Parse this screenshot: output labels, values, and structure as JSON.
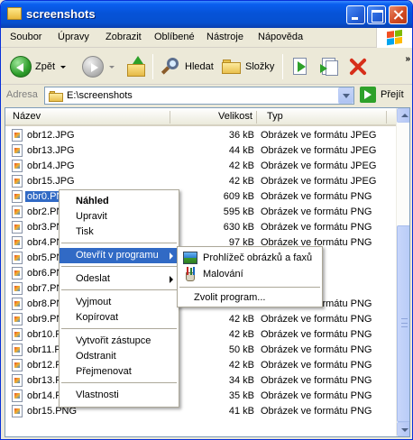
{
  "window": {
    "title": "screenshots"
  },
  "menubar": [
    {
      "label": "Soubor"
    },
    {
      "label": "Úpravy"
    },
    {
      "label": "Zobrazit"
    },
    {
      "label": "Oblíbené"
    },
    {
      "label": "Nástroje"
    },
    {
      "label": "Nápověda"
    }
  ],
  "toolbar": {
    "back_label": "Zpět",
    "search_label": "Hledat",
    "folders_label": "Složky",
    "chevron": "»"
  },
  "address": {
    "label": "Adresa",
    "value": "E:\\screenshots",
    "go_label": "Přejít"
  },
  "columns": {
    "name": "Název",
    "size": "Velikost",
    "type": "Typ"
  },
  "files": [
    {
      "name": "obr12.JPG",
      "size": "36 kB",
      "type": "Obrázek ve formátu JPEG"
    },
    {
      "name": "obr13.JPG",
      "size": "44 kB",
      "type": "Obrázek ve formátu JPEG"
    },
    {
      "name": "obr14.JPG",
      "size": "42 kB",
      "type": "Obrázek ve formátu JPEG"
    },
    {
      "name": "obr15.JPG",
      "size": "42 kB",
      "type": "Obrázek ve formátu JPEG"
    },
    {
      "name": "obr0.PNG",
      "size": "609 kB",
      "type": "Obrázek ve formátu PNG"
    },
    {
      "name": "obr2.PNG",
      "size": "595 kB",
      "type": "Obrázek ve formátu PNG"
    },
    {
      "name": "obr3.PNG",
      "size": "630 kB",
      "type": "Obrázek ve formátu PNG"
    },
    {
      "name": "obr4.PNG",
      "size": "97 kB",
      "type": "Obrázek ve formátu PNG"
    },
    {
      "name": "obr5.PNG",
      "size": "",
      "type": ""
    },
    {
      "name": "obr6.PNG",
      "size": "",
      "type": ""
    },
    {
      "name": "obr7.PNG",
      "size": "",
      "type": ""
    },
    {
      "name": "obr8.PNG",
      "size": "",
      "type": "Obrázek ve formátu PNG"
    },
    {
      "name": "obr9.PNG",
      "size": "42 kB",
      "type": "Obrázek ve formátu PNG"
    },
    {
      "name": "obr10.PNG",
      "size": "42 kB",
      "type": "Obrázek ve formátu PNG"
    },
    {
      "name": "obr11.PNG",
      "size": "50 kB",
      "type": "Obrázek ve formátu PNG"
    },
    {
      "name": "obr12.PNG",
      "size": "42 kB",
      "type": "Obrázek ve formátu PNG"
    },
    {
      "name": "obr13.PNG",
      "size": "34 kB",
      "type": "Obrázek ve formátu PNG"
    },
    {
      "name": "obr14.PNG",
      "size": "35 kB",
      "type": "Obrázek ve formátu PNG"
    },
    {
      "name": "obr15.PNG",
      "size": "41 kB",
      "type": "Obrázek ve formátu PNG"
    }
  ],
  "files_visible_names": [
    "obr12.JPG",
    "obr13.JPG",
    "obr14.JPG",
    "obr15.JPG",
    "obr0.PN",
    "obr2.PN",
    "obr3.PN",
    "obr4.PN",
    "obr5.PN",
    "obr6.PN",
    "obr7.PN",
    "obr8.PN",
    "obr9.PN",
    "obr10.P",
    "obr11.P",
    "obr12.P",
    "obr13.P",
    "obr14.P",
    "obr15.PNG"
  ],
  "context_menu": {
    "items": {
      "nahled": "Náhled",
      "upravit": "Upravit",
      "tisk": "Tisk",
      "otevrit": "Otevřít v programu",
      "odeslat": "Odeslat",
      "vyjmout": "Vyjmout",
      "kopirovat": "Kopírovat",
      "zastupce": "Vytvořit zástupce",
      "odstranit": "Odstranit",
      "prejmenovat": "Přejmenovat",
      "vlastnosti": "Vlastnosti"
    }
  },
  "submenu": {
    "viewer": "Prohlížeč obrázků a faxů",
    "paint": "Malování",
    "choose": "Zvolit program..."
  },
  "colors": {
    "selection": "#316AC5",
    "titlebar": "#0653D8"
  }
}
